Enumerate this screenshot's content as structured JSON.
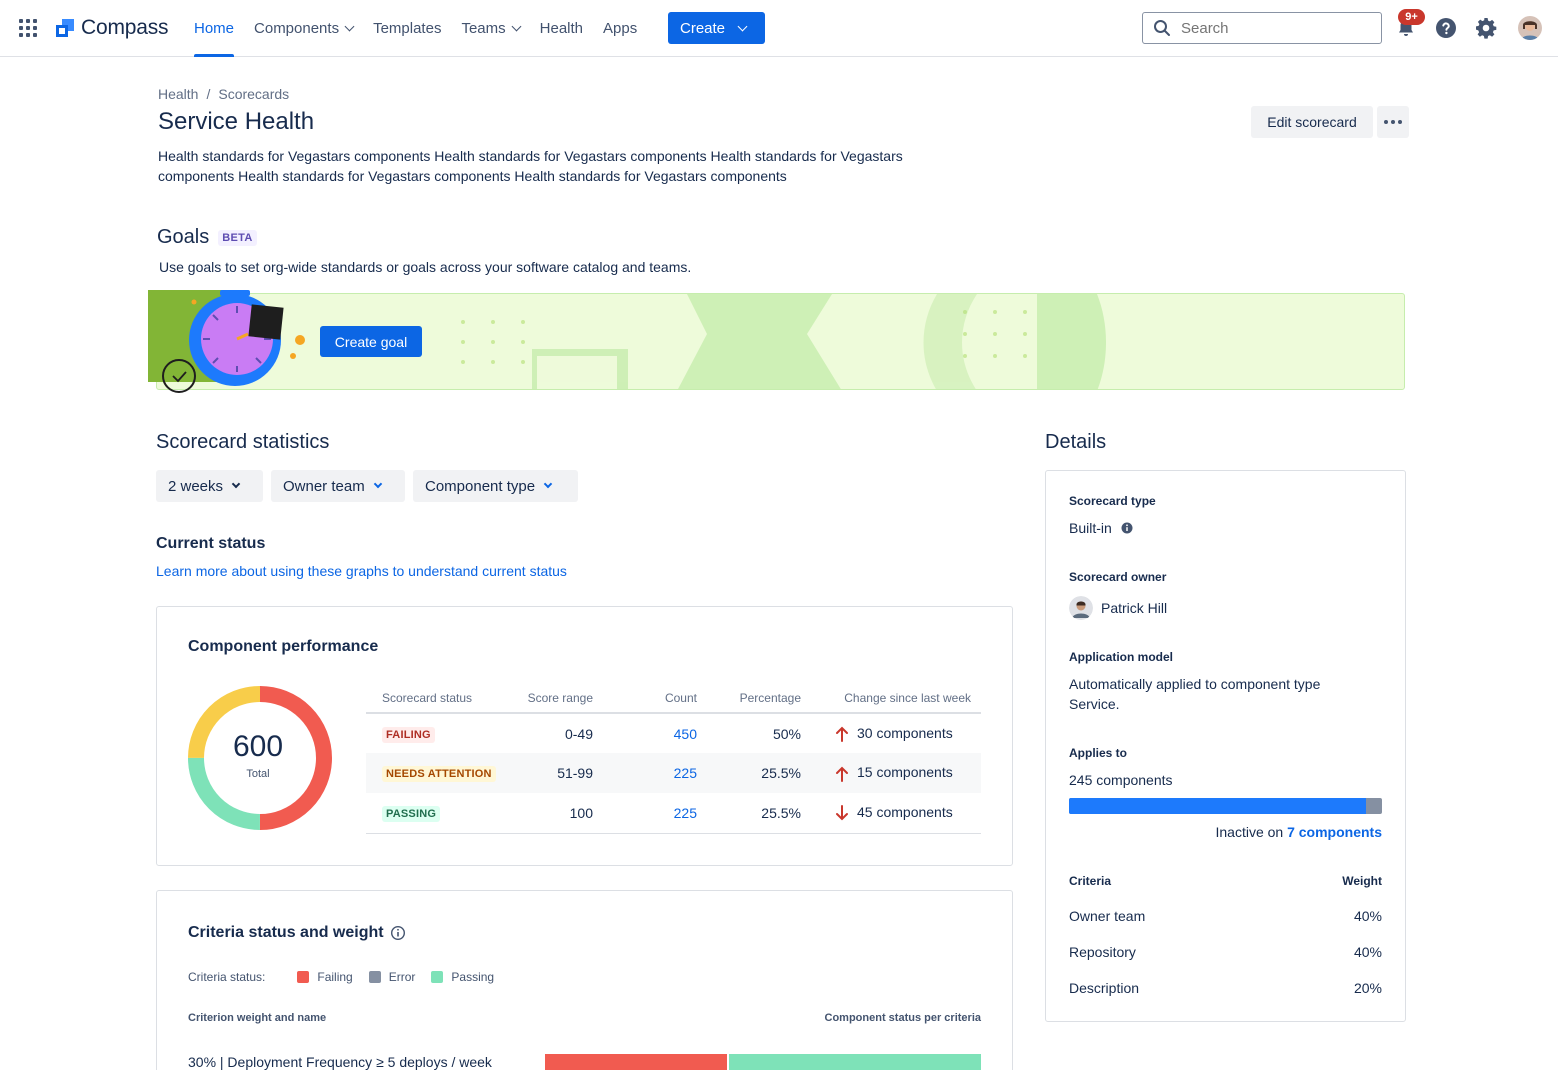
{
  "nav": {
    "product_name": "Compass",
    "items": [
      {
        "label": "Home",
        "active": true
      },
      {
        "label": "Components",
        "dropdown": true
      },
      {
        "label": "Templates"
      },
      {
        "label": "Teams",
        "dropdown": true
      },
      {
        "label": "Health"
      },
      {
        "label": "Apps"
      }
    ],
    "create_label": "Create",
    "search_placeholder": "Search",
    "notification_badge": "9+",
    "icons": [
      "app-switcher-icon",
      "search-icon",
      "notification-icon",
      "help-icon",
      "settings-icon",
      "avatar"
    ],
    "accent_color": "#0c66e4"
  },
  "breadcrumb": [
    "Health",
    "Scorecards"
  ],
  "page": {
    "title": "Service Health",
    "description": "Health standards for Vegastars components Health standards for Vegastars components Health standards for Vegastars components Health standards for Vegastars components Health standards for Vegastars components",
    "edit_label": "Edit scorecard"
  },
  "goals": {
    "title": "Goals",
    "badge": "BETA",
    "description": "Use goals to set org-wide standards or goals across your software catalog and teams.",
    "button_label": "Create goal"
  },
  "statistics": {
    "title": "Scorecard statistics",
    "filters": [
      "2 weeks",
      "Owner team",
      "Component type"
    ],
    "current_status_title": "Current status",
    "learn_link": "Learn more about using these graphs to understand current status"
  },
  "performance": {
    "title": "Component performance",
    "total": "600",
    "total_label": "Total",
    "donut_fractions": {
      "failing": 0.5,
      "passing": 0.25,
      "needs_attention": 0.25
    },
    "colors": {
      "failing": "#f15b50",
      "needs_attention": "#f8cd4a",
      "passing": "#7ee2b8"
    },
    "headers": [
      "Scorecard status",
      "Score range",
      "Count",
      "Percentage",
      "Change since last week"
    ],
    "rows": [
      {
        "status": "FAILING",
        "range": "0-49",
        "count": "450",
        "percentage": "50%",
        "change": "30 components",
        "direction": "up"
      },
      {
        "status": "NEEDS ATTENTION",
        "range": "51-99",
        "count": "225",
        "percentage": "25.5%",
        "change": "15 components",
        "direction": "up"
      },
      {
        "status": "PASSING",
        "range": "100",
        "count": "225",
        "percentage": "25.5%",
        "change": "45 components",
        "direction": "down"
      }
    ]
  },
  "criteria": {
    "title": "Criteria status and weight",
    "legend_label": "Criteria status:",
    "legend": [
      {
        "label": "Failing",
        "color": "#f15b50"
      },
      {
        "label": "Error",
        "color": "#8590a2"
      },
      {
        "label": "Passing",
        "color": "#7ee2b8"
      }
    ],
    "left_header": "Criterion weight and name",
    "right_header": "Component status per criteria",
    "rows": [
      {
        "label": "30% | Deployment Frequency ≥ 5 deploys / week",
        "failing": 0.42,
        "passing": 0.58
      }
    ]
  },
  "details": {
    "title": "Details",
    "scorecard_type_label": "Scorecard type",
    "scorecard_type": "Built-in",
    "owner_label": "Scorecard owner",
    "owner": "Patrick Hill",
    "model_label": "Application model",
    "model": "Automatically applied to component type Service.",
    "applies_label": "Applies to",
    "applies": "245 components",
    "active_fraction": 0.95,
    "inactive_prefix": "Inactive on",
    "inactive_link": "7 components",
    "criteria_header": "Criteria",
    "weight_header": "Weight",
    "criteria": [
      {
        "name": "Owner team",
        "weight": "40%"
      },
      {
        "name": "Repository",
        "weight": "40%"
      },
      {
        "name": "Description",
        "weight": "20%"
      }
    ]
  }
}
